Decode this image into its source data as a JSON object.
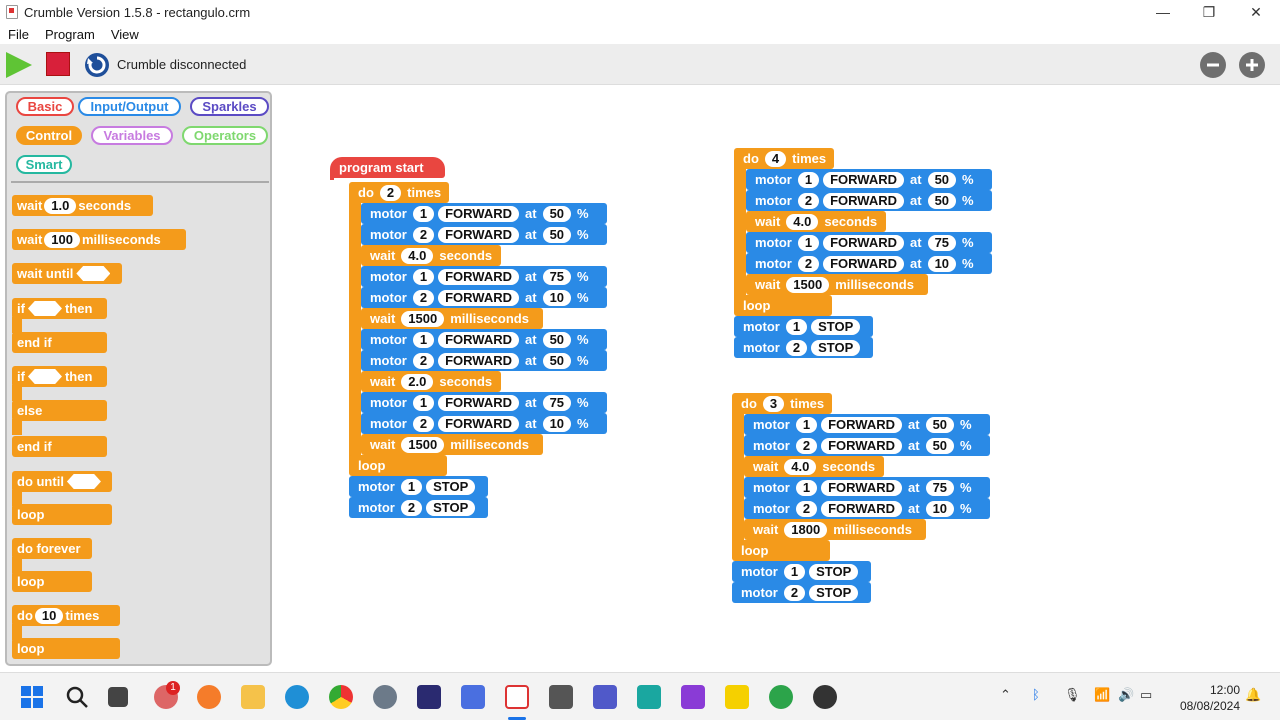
{
  "window": {
    "title": "Crumble Version 1.5.8 - rectangulo.crm",
    "minimize": "—",
    "maximize": "❐",
    "close": "✕"
  },
  "menu": [
    "File",
    "Program",
    "View"
  ],
  "toolbar": {
    "status": "Crumble disconnected"
  },
  "palette": {
    "categories": [
      "Basic",
      "Input/Output",
      "Sparkles",
      "Control",
      "Variables",
      "Operators",
      "Smart"
    ],
    "blocks": {
      "wait": "wait",
      "seconds": "seconds",
      "wait_seconds_value": "1.0",
      "milliseconds": "milliseconds",
      "wait_ms_value": "100",
      "wait_until": "wait until",
      "if": "if",
      "then": "then",
      "end_if": "end if",
      "else": "else",
      "do_until": "do until",
      "loop": "loop",
      "do_forever": "do forever",
      "do": "do",
      "times": "times",
      "do_times_value": "10"
    }
  },
  "script1": {
    "start": "program start",
    "do_count": "2",
    "rows": [
      {
        "type": "motor",
        "n": "1",
        "dir": "FORWARD",
        "speed": "50"
      },
      {
        "type": "motor",
        "n": "2",
        "dir": "FORWARD",
        "speed": "50"
      },
      {
        "type": "wait",
        "value": "4.0",
        "unit": "seconds"
      },
      {
        "type": "motor",
        "n": "1",
        "dir": "FORWARD",
        "speed": "75"
      },
      {
        "type": "motor",
        "n": "2",
        "dir": "FORWARD",
        "speed": "10"
      },
      {
        "type": "wait",
        "value": "1500",
        "unit": "milliseconds"
      },
      {
        "type": "motor",
        "n": "1",
        "dir": "FORWARD",
        "speed": "50"
      },
      {
        "type": "motor",
        "n": "2",
        "dir": "FORWARD",
        "speed": "50"
      },
      {
        "type": "wait",
        "value": "2.0",
        "unit": "seconds"
      },
      {
        "type": "motor",
        "n": "1",
        "dir": "FORWARD",
        "speed": "75"
      },
      {
        "type": "motor",
        "n": "2",
        "dir": "FORWARD",
        "speed": "10"
      },
      {
        "type": "wait",
        "value": "1500",
        "unit": "milliseconds"
      }
    ],
    "stops": [
      "1",
      "2"
    ]
  },
  "script2": {
    "do_count": "4",
    "rows": [
      {
        "type": "motor",
        "n": "1",
        "dir": "FORWARD",
        "speed": "50"
      },
      {
        "type": "motor",
        "n": "2",
        "dir": "FORWARD",
        "speed": "50"
      },
      {
        "type": "wait",
        "value": "4.0",
        "unit": "seconds"
      },
      {
        "type": "motor",
        "n": "1",
        "dir": "FORWARD",
        "speed": "75"
      },
      {
        "type": "motor",
        "n": "2",
        "dir": "FORWARD",
        "speed": "10"
      },
      {
        "type": "wait",
        "value": "1500",
        "unit": "milliseconds"
      }
    ],
    "stops": [
      "1",
      "2"
    ]
  },
  "script3": {
    "do_count": "3",
    "rows": [
      {
        "type": "motor",
        "n": "1",
        "dir": "FORWARD",
        "speed": "50"
      },
      {
        "type": "motor",
        "n": "2",
        "dir": "FORWARD",
        "speed": "50"
      },
      {
        "type": "wait",
        "value": "4.0",
        "unit": "seconds"
      },
      {
        "type": "motor",
        "n": "1",
        "dir": "FORWARD",
        "speed": "75"
      },
      {
        "type": "motor",
        "n": "2",
        "dir": "FORWARD",
        "speed": "10"
      },
      {
        "type": "wait",
        "value": "1800",
        "unit": "milliseconds"
      }
    ],
    "stops": [
      "1",
      "2"
    ]
  },
  "labels": {
    "motor": "motor",
    "at": "at",
    "percent": "%",
    "stop": "STOP",
    "do": "do",
    "times": "times",
    "loop": "loop"
  },
  "taskbar": {
    "time": "12:00",
    "date": "08/08/2024",
    "badge": "1"
  },
  "colors": {
    "control": "#f49b1b",
    "motor": "#2a8ae6",
    "start": "#e94640"
  }
}
